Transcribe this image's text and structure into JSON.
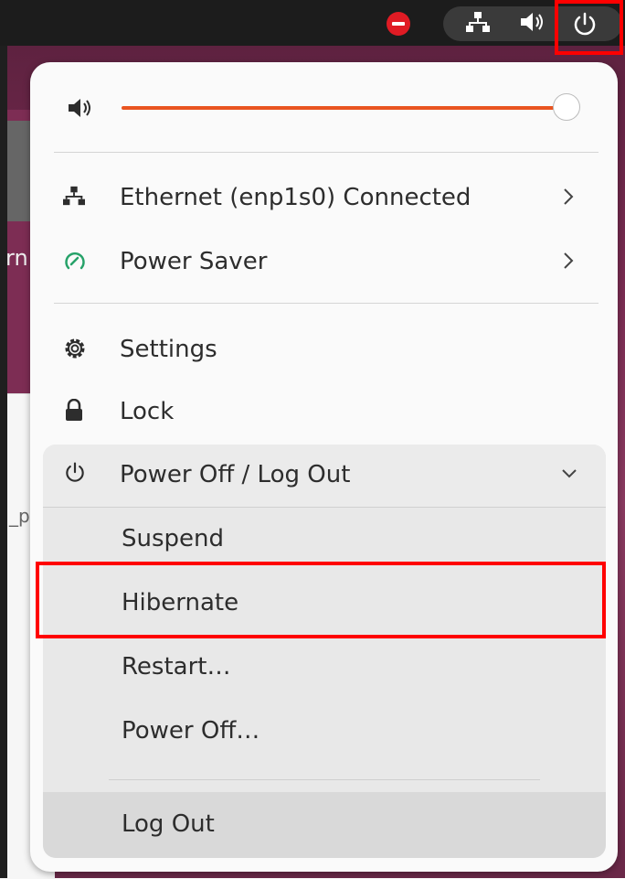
{
  "topbar": {
    "icons": [
      "do-not-disturb-icon",
      "network-icon",
      "volume-icon",
      "power-icon"
    ]
  },
  "background": {
    "partial_text_1": "rn",
    "partial_text_2": "_p"
  },
  "menu": {
    "volume": {
      "icon": "volume-icon",
      "level": 1.0
    },
    "network": {
      "icon": "network-icon",
      "label": "Ethernet (enp1s0) Connected"
    },
    "power_mode": {
      "icon": "power-saver-icon",
      "label": "Power Saver"
    },
    "settings": {
      "icon": "gear-icon",
      "label": "Settings"
    },
    "lock": {
      "icon": "lock-icon",
      "label": "Lock"
    },
    "power_section": {
      "icon": "power-icon",
      "label": "Power Off / Log Out",
      "items": [
        {
          "label": "Suspend"
        },
        {
          "label": "Hibernate"
        },
        {
          "label": "Restart…"
        },
        {
          "label": "Power Off…"
        },
        {
          "label": "Log Out"
        }
      ]
    }
  },
  "colors": {
    "accent": "#e95420",
    "highlight_box": "#ff0000",
    "power_saver_green": "#26a269"
  }
}
